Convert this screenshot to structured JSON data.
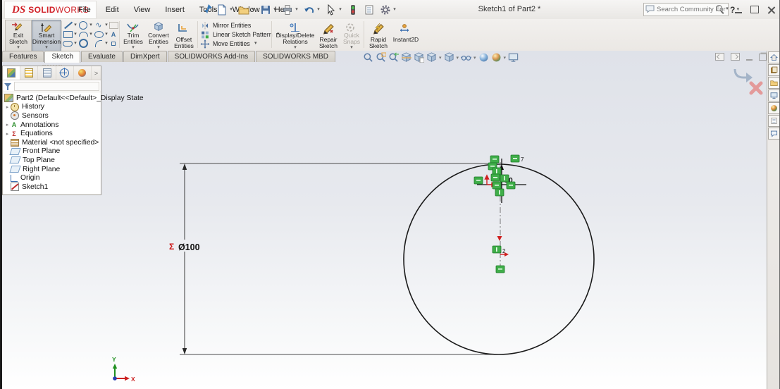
{
  "titlebar": {
    "logo_mark": "DS",
    "logo_bold": "SOLID",
    "logo_light": "WORKS",
    "menus": [
      "File",
      "Edit",
      "View",
      "Insert",
      "Tools",
      "Window",
      "Help"
    ],
    "document_title": "Sketch1 of Part2 *",
    "search_placeholder": "Search Community Forum",
    "help_label": "?"
  },
  "ribbon": {
    "exit_sketch": "Exit Sketch",
    "smart_dimension": "Smart Dimension",
    "trim_entities": "Trim Entities",
    "convert_entities": "Convert Entities",
    "offset_entities": "Offset Entities",
    "mirror_entities": "Mirror Entities",
    "linear_sketch_pattern": "Linear Sketch Pattern",
    "move_entities": "Move Entities",
    "display_delete_relations": "Display/Delete Relations",
    "repair_sketch": "Repair Sketch",
    "quick_snaps": "Quick Snaps",
    "rapid_sketch": "Rapid Sketch",
    "instant2d": "Instant2D"
  },
  "tabs": {
    "items": [
      "Features",
      "Sketch",
      "Evaluate",
      "DimXpert",
      "SOLIDWORKS Add-Ins",
      "SOLIDWORKS MBD"
    ],
    "active": "Sketch"
  },
  "feature_tree": {
    "root": "Part2 (Default<<Default>_Display State",
    "items": [
      "History",
      "Sensors",
      "Annotations",
      "Equations",
      "Material <not specified>",
      "Front Plane",
      "Top Plane",
      "Right Plane",
      "Origin",
      "Sketch1"
    ]
  },
  "canvas": {
    "dimension_sigma": "Σ",
    "dimension_value": "Ø100",
    "small_dimension": "10",
    "relation_subscript_top": "7",
    "relation_subscript_center": "2",
    "triad_x": "X",
    "triad_y": "Y"
  },
  "glyphs": {
    "panel_chevron": ">",
    "accent_green": "#3fae49",
    "accent_red": "#cc2222",
    "icon_blue": "#3c6e9f"
  }
}
